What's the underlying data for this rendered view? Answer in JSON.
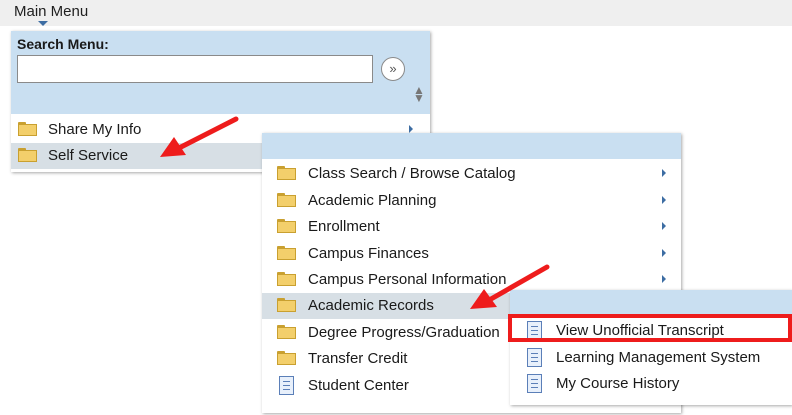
{
  "top_bar": {
    "title": "Main Menu"
  },
  "search": {
    "label": "Search Menu:",
    "value": "",
    "go_icon": "double-chevron-right-icon",
    "sort_icon": "up-down-arrows-icon"
  },
  "main_menu": {
    "items": [
      {
        "label": "Share My Info",
        "icon": "folder-icon",
        "has_submenu": true
      },
      {
        "label": "Self Service",
        "icon": "folder-icon",
        "has_submenu": true,
        "selected": true
      }
    ]
  },
  "self_service_menu": {
    "items": [
      {
        "label": "Class Search / Browse Catalog",
        "icon": "folder-icon",
        "has_submenu": true
      },
      {
        "label": "Academic Planning",
        "icon": "folder-icon",
        "has_submenu": true
      },
      {
        "label": "Enrollment",
        "icon": "folder-icon",
        "has_submenu": true
      },
      {
        "label": "Campus Finances",
        "icon": "folder-icon",
        "has_submenu": true
      },
      {
        "label": "Campus Personal Information",
        "icon": "folder-icon",
        "has_submenu": true
      },
      {
        "label": "Academic Records",
        "icon": "folder-icon",
        "has_submenu": true,
        "selected": true
      },
      {
        "label": "Degree Progress/Graduation",
        "icon": "folder-icon",
        "has_submenu": true
      },
      {
        "label": "Transfer Credit",
        "icon": "folder-icon",
        "has_submenu": true
      },
      {
        "label": "Student Center",
        "icon": "document-icon",
        "has_submenu": false
      }
    ]
  },
  "academic_records_menu": {
    "items": [
      {
        "label": "View Unofficial Transcript",
        "icon": "document-icon",
        "highlighted": true
      },
      {
        "label": "Learning Management System",
        "icon": "document-icon"
      },
      {
        "label": "My Course History",
        "icon": "document-icon"
      }
    ]
  },
  "colors": {
    "menu_header_blue": "#c9dff1",
    "selected_row": "#d7dfe5",
    "annotation_red": "#ee1c1c",
    "submenu_arrow": "#3d6da3"
  }
}
